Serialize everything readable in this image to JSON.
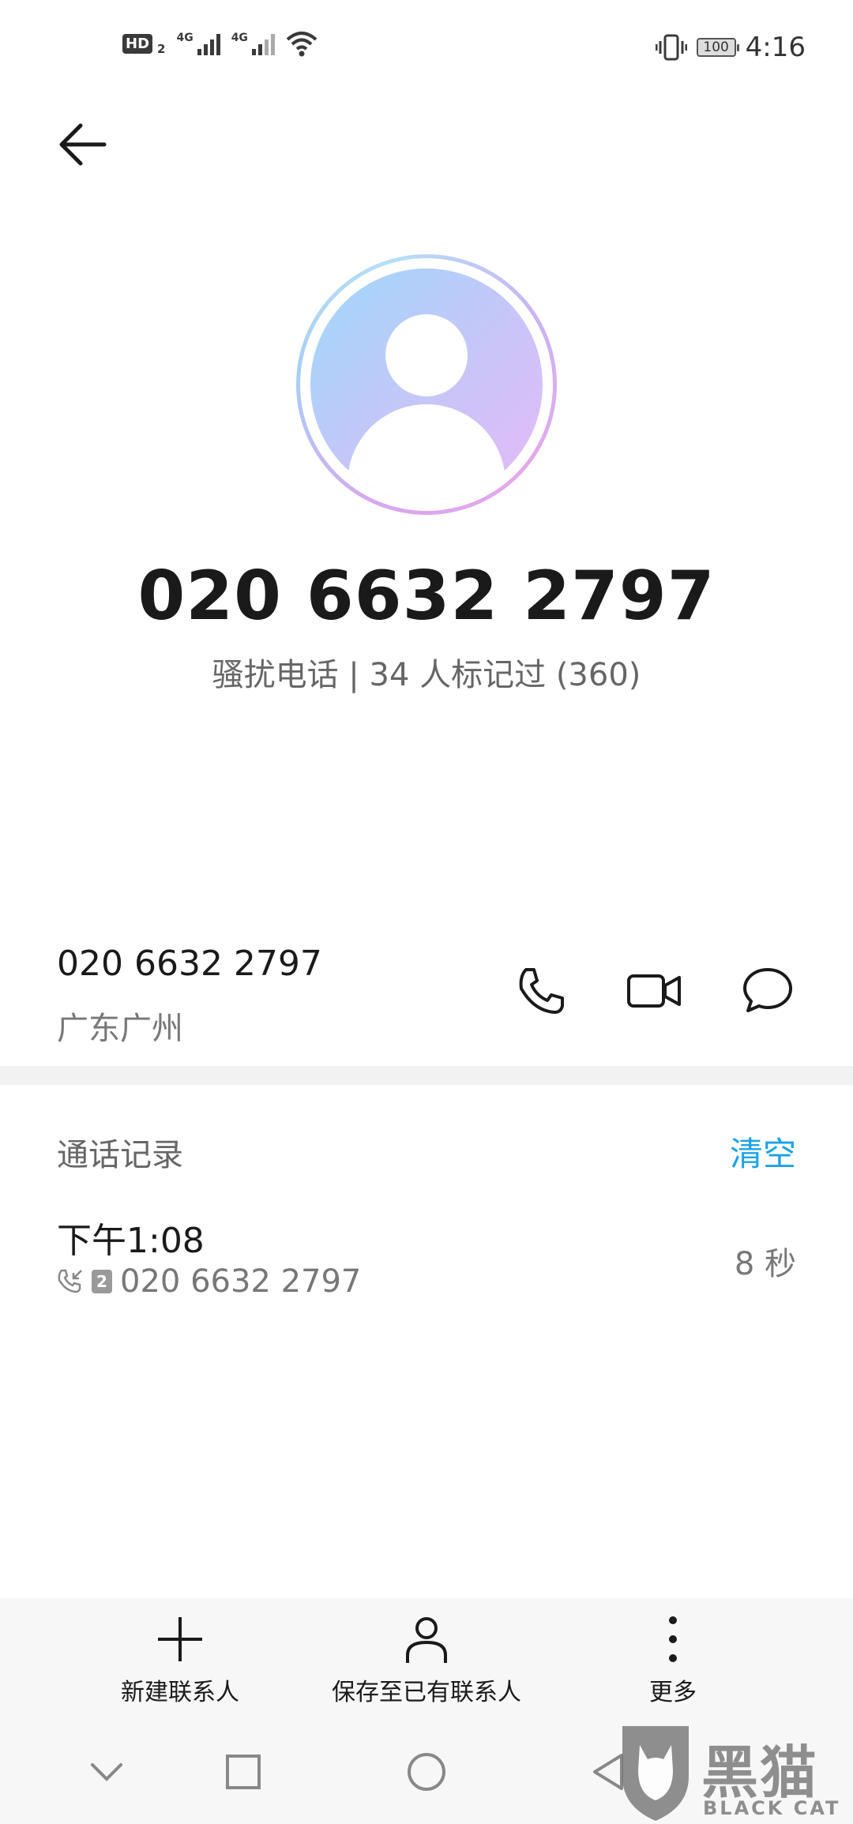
{
  "status_bar": {
    "hd_label": "HD",
    "hd_sim": "2",
    "signal1_label": "4G",
    "signal2_label": "4G",
    "battery": "100",
    "time": "4:16"
  },
  "contact": {
    "number": "020 6632 2797",
    "tag_line": "骚扰电话 | 34 人标记过 (360)"
  },
  "number_row": {
    "number": "020 6632 2797",
    "location": "广东广州"
  },
  "call_log": {
    "title": "通话记录",
    "clear_label": "清空",
    "entries": [
      {
        "time": "下午1:08",
        "sim": "2",
        "number": "020 6632 2797",
        "duration": "8 秒"
      }
    ]
  },
  "bottom_actions": {
    "new_contact": "新建联系人",
    "save_existing": "保存至已有联系人",
    "more": "更多"
  },
  "watermark": {
    "text": "黑猫",
    "sub": "BLACK CAT"
  },
  "colors": {
    "accent": "#1aa3e8",
    "text_primary": "#1a1a1a",
    "text_secondary": "#777777"
  }
}
